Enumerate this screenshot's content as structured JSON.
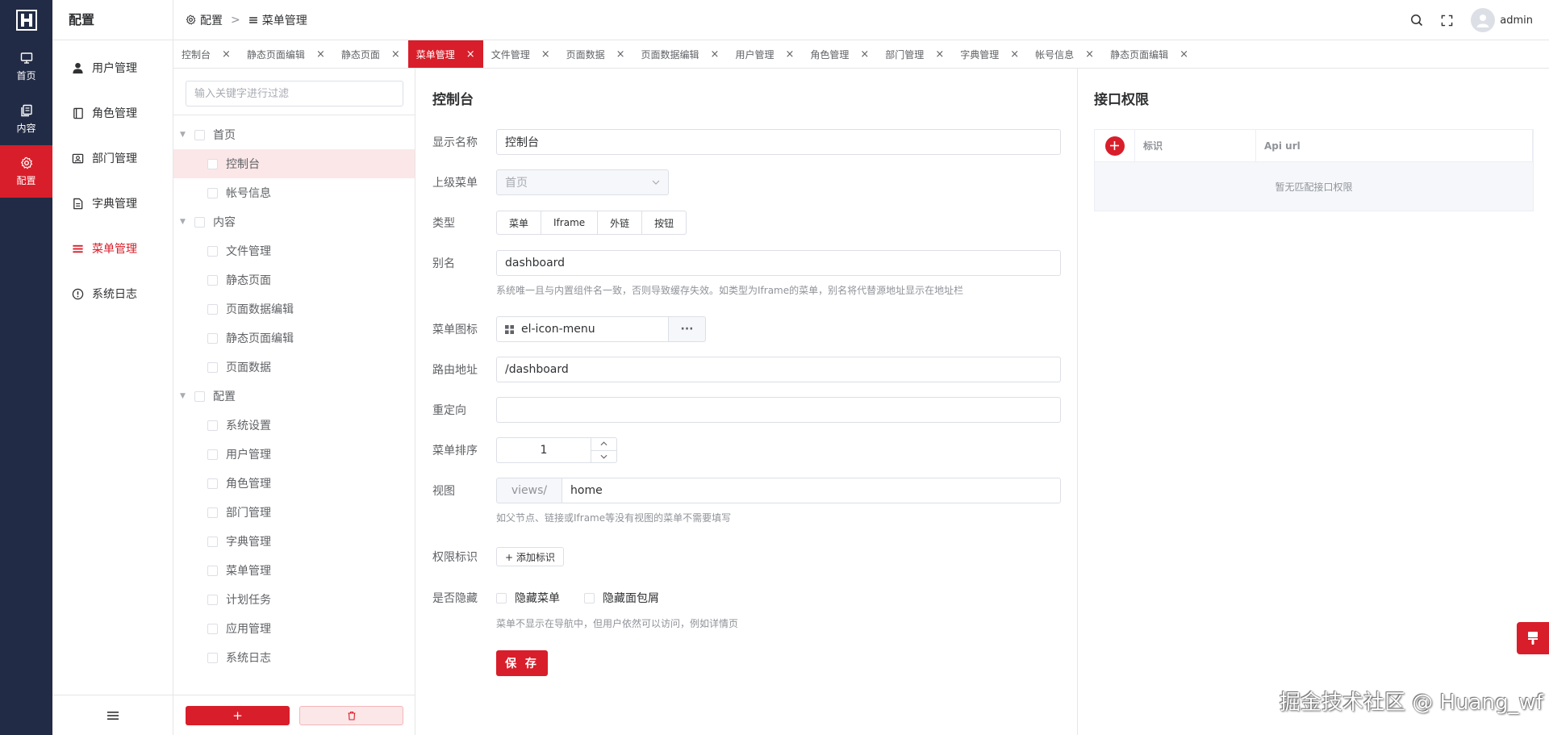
{
  "colors": {
    "accent": "#d81e2a",
    "rail_bg": "#222b45"
  },
  "rail": {
    "items": [
      {
        "label": "首页",
        "icon": "monitor-icon"
      },
      {
        "label": "内容",
        "icon": "copy-icon"
      },
      {
        "label": "配置",
        "icon": "gear-icon"
      }
    ]
  },
  "submenu": {
    "title": "配置",
    "items": [
      {
        "label": "用户管理",
        "icon": "user-icon"
      },
      {
        "label": "角色管理",
        "icon": "notebook-icon"
      },
      {
        "label": "部门管理",
        "icon": "postcard-icon"
      },
      {
        "label": "字典管理",
        "icon": "document-icon"
      },
      {
        "label": "菜单管理",
        "icon": "menu-icon"
      },
      {
        "label": "系统日志",
        "icon": "warning-icon"
      }
    ]
  },
  "header": {
    "breadcrumb": [
      {
        "label": "配置",
        "icon": "gear-icon"
      },
      {
        "label": "菜单管理",
        "icon": "menu-icon"
      }
    ],
    "username": "admin"
  },
  "tabs": [
    {
      "label": "控制台"
    },
    {
      "label": "静态页面编辑"
    },
    {
      "label": "静态页面"
    },
    {
      "label": "菜单管理",
      "active": true
    },
    {
      "label": "文件管理"
    },
    {
      "label": "页面数据"
    },
    {
      "label": "页面数据编辑"
    },
    {
      "label": "用户管理"
    },
    {
      "label": "角色管理"
    },
    {
      "label": "部门管理"
    },
    {
      "label": "字典管理"
    },
    {
      "label": "帐号信息"
    },
    {
      "label": "静态页面编辑"
    }
  ],
  "tree": {
    "filter_placeholder": "输入关键字进行过滤",
    "nodes": [
      {
        "label": "首页",
        "level": 1
      },
      {
        "label": "控制台",
        "level": 2,
        "selected": true
      },
      {
        "label": "帐号信息",
        "level": 2
      },
      {
        "label": "内容",
        "level": 1
      },
      {
        "label": "文件管理",
        "level": 2
      },
      {
        "label": "静态页面",
        "level": 2
      },
      {
        "label": "页面数据编辑",
        "level": 2
      },
      {
        "label": "静态页面编辑",
        "level": 2
      },
      {
        "label": "页面数据",
        "level": 2
      },
      {
        "label": "配置",
        "level": 1
      },
      {
        "label": "系统设置",
        "level": 2
      },
      {
        "label": "用户管理",
        "level": 2
      },
      {
        "label": "角色管理",
        "level": 2
      },
      {
        "label": "部门管理",
        "level": 2
      },
      {
        "label": "字典管理",
        "level": 2
      },
      {
        "label": "菜单管理",
        "level": 2
      },
      {
        "label": "计划任务",
        "level": 2
      },
      {
        "label": "应用管理",
        "level": 2
      },
      {
        "label": "系统日志",
        "level": 2
      }
    ],
    "add_label": "+"
  },
  "form": {
    "title": "控制台",
    "display_name": {
      "label": "显示名称",
      "value": "控制台"
    },
    "parent_menu": {
      "label": "上级菜单",
      "value": "首页"
    },
    "type": {
      "label": "类型",
      "options": [
        "菜单",
        "Iframe",
        "外链",
        "按钮"
      ]
    },
    "alias": {
      "label": "别名",
      "value": "dashboard",
      "hint": "系统唯一且与内置组件名一致，否则导致缓存失效。如类型为Iframe的菜单，别名将代替源地址显示在地址栏"
    },
    "icon": {
      "label": "菜单图标",
      "value": "el-icon-menu",
      "button": "···"
    },
    "route": {
      "label": "路由地址",
      "value": "/dashboard"
    },
    "redirect": {
      "label": "重定向",
      "value": ""
    },
    "sort": {
      "label": "菜单排序",
      "value": "1"
    },
    "view": {
      "label": "视图",
      "prefix": "views/",
      "value": "home",
      "hint": "如父节点、链接或Iframe等没有视图的菜单不需要填写"
    },
    "perm": {
      "label": "权限标识",
      "button": "+ 添加标识"
    },
    "hidden": {
      "label": "是否隐藏",
      "opt1": "隐藏菜单",
      "opt2": "隐藏面包屑",
      "hint": "菜单不显示在导航中，但用户依然可以访问，例如详情页"
    },
    "save": "保 存"
  },
  "api": {
    "title": "接口权限",
    "columns": [
      "标识",
      "Api url"
    ],
    "empty": "暂无匹配接口权限"
  },
  "watermark": "掘金技术社区 @ Huang_wf"
}
